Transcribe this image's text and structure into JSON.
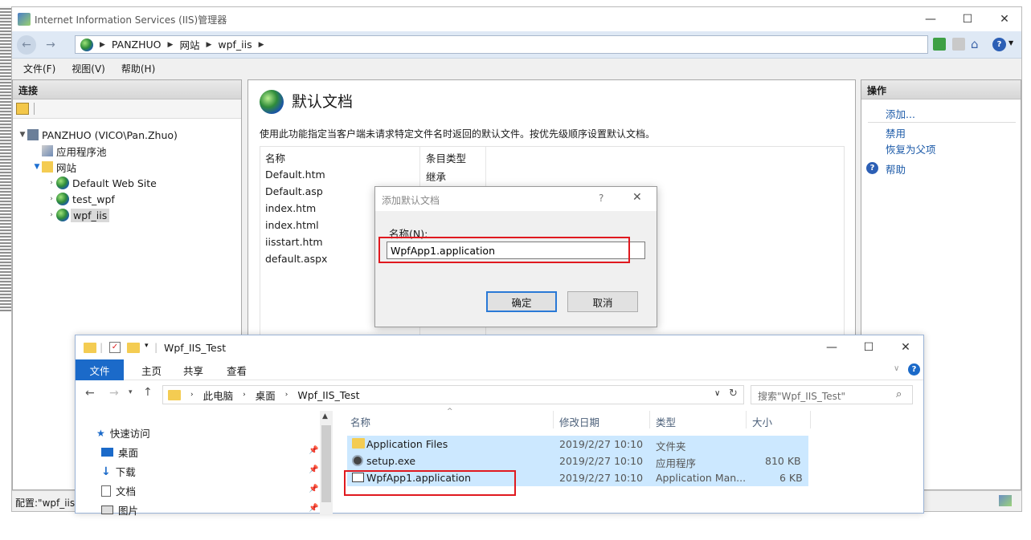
{
  "iis": {
    "window_title": "Internet Information Services (IIS)管理器",
    "breadcrumb": [
      "PANZHUO",
      "网站",
      "wpf_iis"
    ],
    "menu": [
      "文件(F)",
      "视图(V)",
      "帮助(H)"
    ],
    "connections": {
      "title": "连接",
      "tree": [
        {
          "label": "PANZHUO (VICO\\Pan.Zhuo)",
          "level": 0,
          "icon": "server-icon",
          "expanded": true
        },
        {
          "label": "应用程序池",
          "level": 1,
          "icon": "app-pool-icon"
        },
        {
          "label": "网站",
          "level": 1,
          "icon": "sites-folder-icon",
          "expanded": true
        },
        {
          "label": "Default Web Site",
          "level": 2,
          "icon": "globe-icon"
        },
        {
          "label": "test_wpf",
          "level": 2,
          "icon": "globe-icon"
        },
        {
          "label": "wpf_iis",
          "level": 2,
          "icon": "globe-icon",
          "selected": true
        }
      ]
    },
    "feature": {
      "title": "默认文档",
      "description": "使用此功能指定当客户端未请求特定文件名时返回的默认文件。按优先级顺序设置默认文档。",
      "columns": [
        "名称",
        "条目类型"
      ],
      "rows": [
        {
          "name": "Default.htm",
          "type": "继承"
        },
        {
          "name": "Default.asp",
          "type": "继承"
        },
        {
          "name": "index.htm",
          "type": ""
        },
        {
          "name": "index.html",
          "type": ""
        },
        {
          "name": "iisstart.htm",
          "type": ""
        },
        {
          "name": "default.aspx",
          "type": ""
        }
      ]
    },
    "actions": {
      "title": "操作",
      "add": "添加...",
      "disable": "禁用",
      "revert": "恢复为父项",
      "help": "帮助"
    },
    "status": "配置:\"wpf_iis\""
  },
  "dialog": {
    "title": "添加默认文档",
    "help_glyph": "?",
    "label": "名称(N):",
    "value": "WpfApp1.application",
    "ok": "确定",
    "cancel": "取消"
  },
  "explorer": {
    "title": "Wpf_IIS_Test",
    "tabs": [
      "文件",
      "主页",
      "共享",
      "查看"
    ],
    "path": [
      "此电脑",
      "桌面",
      "Wpf_IIS_Test"
    ],
    "search_placeholder": "搜索\"Wpf_IIS_Test\"",
    "nav": [
      {
        "label": "快速访问",
        "icon": "star-icon"
      },
      {
        "label": "桌面",
        "icon": "desktop-icon"
      },
      {
        "label": "下载",
        "icon": "download-icon"
      },
      {
        "label": "文档",
        "icon": "document-icon"
      },
      {
        "label": "图片",
        "icon": "pictures-icon"
      }
    ],
    "columns": [
      "名称",
      "修改日期",
      "类型",
      "大小"
    ],
    "files": [
      {
        "name": "Application Files",
        "date": "2019/2/27 10:10",
        "type": "文件夹",
        "size": "",
        "icon": "folder-icon"
      },
      {
        "name": "setup.exe",
        "date": "2019/2/27 10:10",
        "type": "应用程序",
        "size": "810 KB",
        "icon": "setup-icon"
      },
      {
        "name": "WpfApp1.application",
        "date": "2019/2/27 10:10",
        "type": "Application Man...",
        "size": "6 KB",
        "icon": "application-manifest-icon"
      }
    ]
  },
  "colors": {
    "accent": "#1b6ac9",
    "highlight": "#e0191f",
    "selection": "#cce8ff"
  }
}
